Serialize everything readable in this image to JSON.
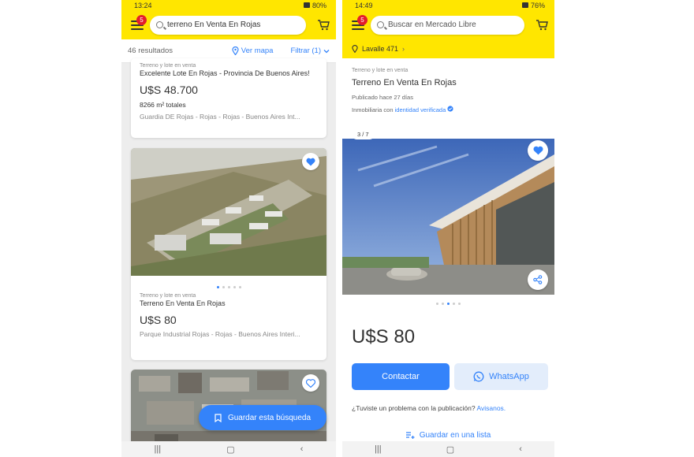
{
  "left": {
    "status": {
      "time": "13:24",
      "battery": "80%"
    },
    "header": {
      "badge": "5",
      "search_text": "terreno En  Venta En Rojas"
    },
    "toolbar": {
      "results": "46 resultados",
      "map": "Ver mapa",
      "filter": "Filtrar (1)"
    },
    "cards": [
      {
        "category": "Terreno y lote en venta",
        "title": "Excelente Lote En Rojas - Provincia De Buenos Aires!",
        "price": "U$S 48.700",
        "area": "8266 m² totales",
        "location": "Guardia DE Rojas - Rojas - Rojas - Buenos Aires Int..."
      },
      {
        "category": "Terreno y lote en venta",
        "title": "Terreno En  Venta En Rojas",
        "price": "U$S 80",
        "location": "Parque Industrial Rojas - Rojas - Buenos Aires Interi..."
      }
    ],
    "save_search": "Guardar esta búsqueda"
  },
  "right": {
    "status": {
      "time": "14:49",
      "battery": "76%"
    },
    "header": {
      "badge": "5",
      "search_placeholder": "Buscar en Mercado Libre"
    },
    "address": "Lavalle 471",
    "listing": {
      "category": "Terreno y lote en venta",
      "title": "Terreno En  Venta En Rojas",
      "published": "Publicado hace 27 días",
      "seller_prefix": "Inmobiliaria con",
      "seller_verified": "identidad verificada",
      "photo_counter": "3 / 7",
      "price": "U$S 80"
    },
    "actions": {
      "contact": "Contactar",
      "whatsapp": "WhatsApp"
    },
    "report": {
      "text": "¿Tuviste un problema con la publicación?",
      "link": "Avisanos."
    },
    "add_list": "Guardar en una lista"
  },
  "colors": {
    "brand_yellow": "#ffe600",
    "accent_blue": "#3483fa",
    "badge_red": "#e41e2b"
  },
  "icons": [
    "menu-icon",
    "search-icon",
    "cart-icon",
    "location-pin-icon",
    "chevron-down-icon",
    "heart-icon",
    "bookmark-icon",
    "share-icon",
    "whatsapp-icon",
    "verified-icon",
    "add-list-icon"
  ]
}
